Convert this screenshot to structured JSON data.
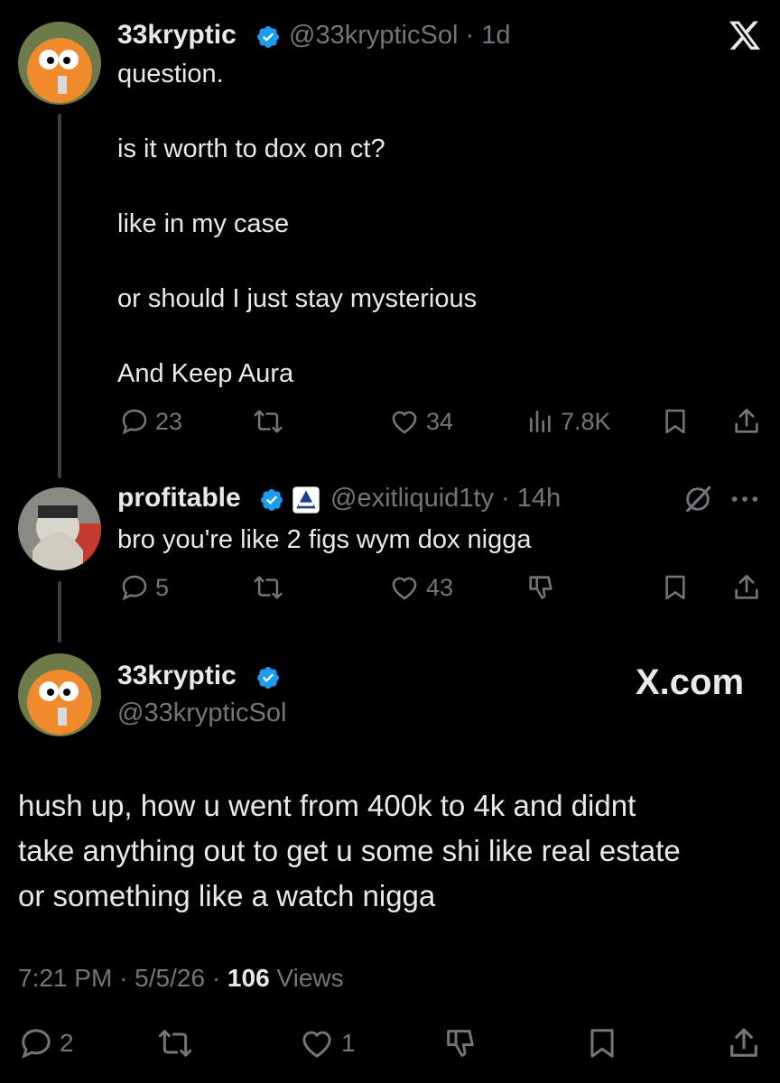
{
  "header": {
    "close_icon": "x-logo-icon"
  },
  "tweet1": {
    "author_name": "33kryptic",
    "handle": "@33krypticSol",
    "separator": "·",
    "age": "1d",
    "lines": [
      "question.",
      "is it worth to dox on ct?",
      "like in my case",
      "or should I just stay mysterious",
      "And Keep Aura"
    ],
    "replies": "23",
    "likes": "34",
    "views": "7.8K"
  },
  "tweet2": {
    "author_name": "profitable",
    "handle": "@exitliquid1ty",
    "separator": "·",
    "age": "14h",
    "text": "bro you're like 2 figs wym dox nigga",
    "replies": "5",
    "likes": "43"
  },
  "main_tweet": {
    "author_name": "33kryptic",
    "handle": "@33krypticSol",
    "brand": "X.com",
    "lines": [
      "hush up, how u went from 400k to 4k and didnt",
      "take anything out to get u some shi like real estate",
      "or something like a watch nigga"
    ],
    "time": "7:21 PM",
    "date": "5/5/26",
    "dot": "·",
    "views_count": "106",
    "views_label": "Views",
    "replies": "2",
    "likes": "1"
  },
  "colors": {
    "background": "#000000",
    "text": "#e7e9ea",
    "muted": "#71767b",
    "verified": "#1d9bf0",
    "thread_line": "#3a3d41"
  }
}
